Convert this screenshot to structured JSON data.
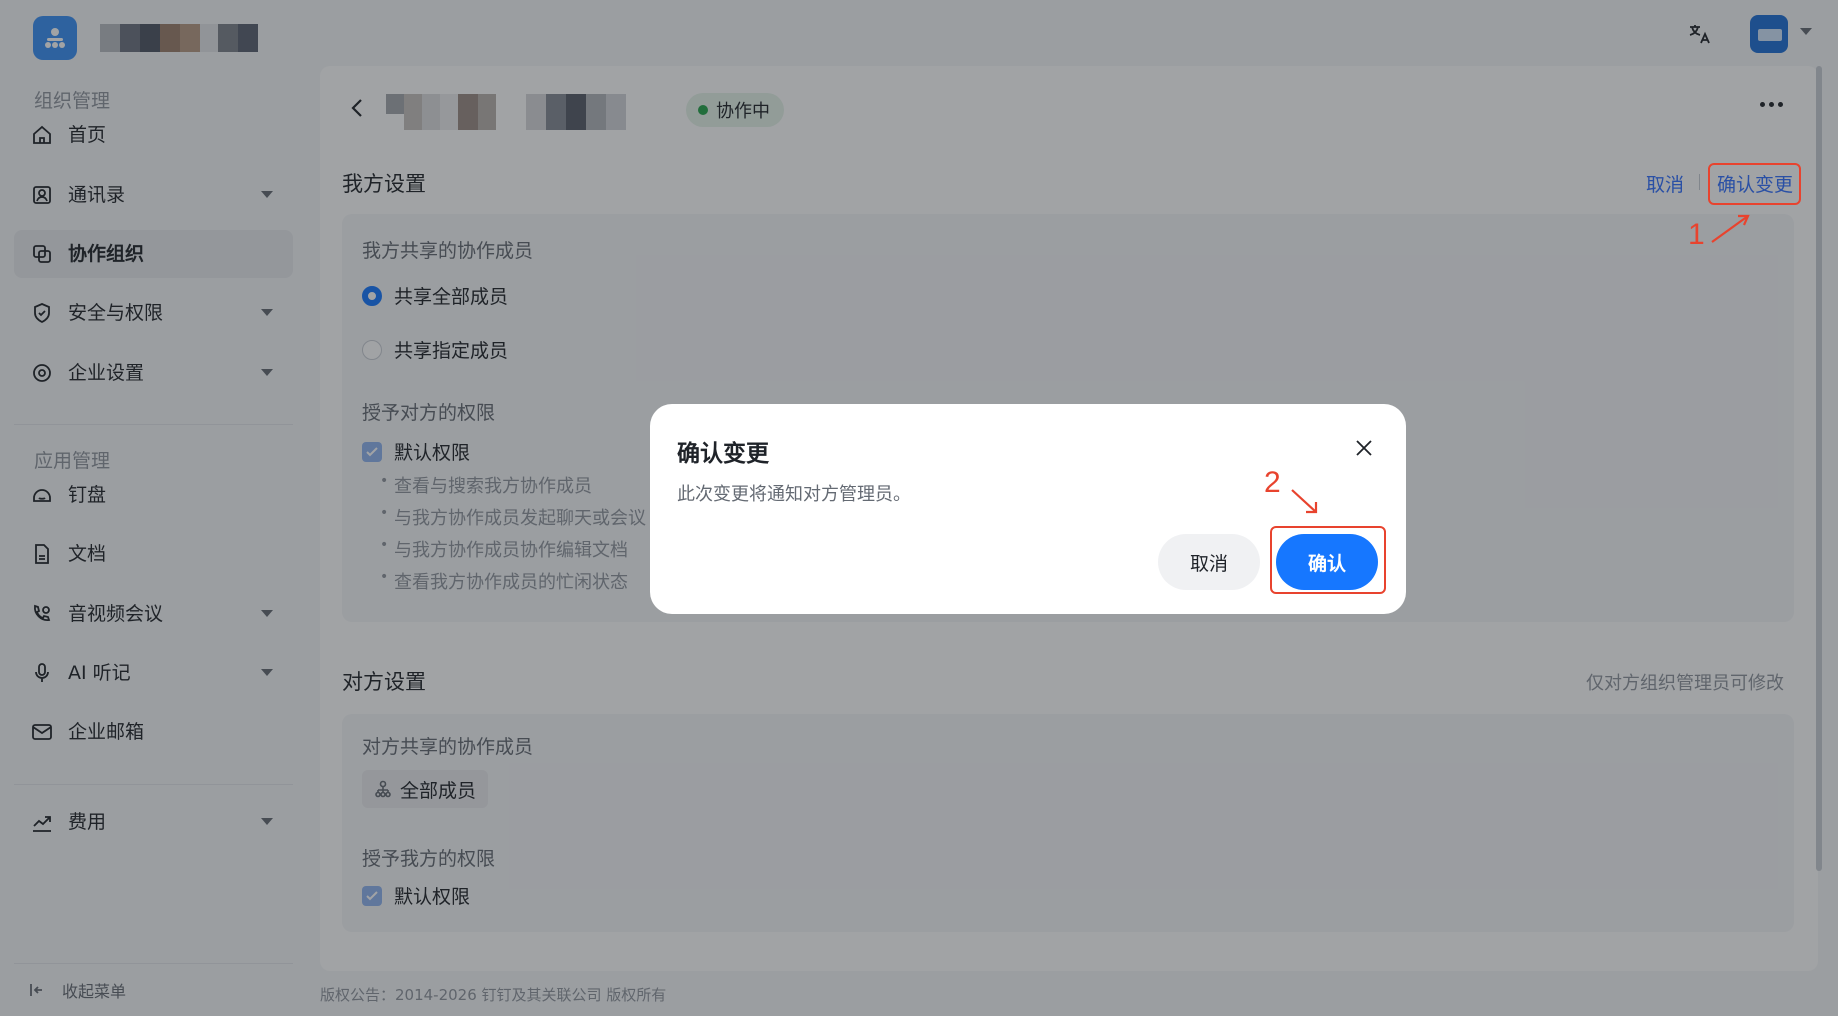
{
  "sidebar": {
    "section_org": "组织管理",
    "section_app": "应用管理",
    "items": [
      {
        "label": "首页"
      },
      {
        "label": "通讯录"
      },
      {
        "label": "协作组织"
      },
      {
        "label": "安全与权限"
      },
      {
        "label": "企业设置"
      },
      {
        "label": "钉盘"
      },
      {
        "label": "文档"
      },
      {
        "label": "音视频会议"
      },
      {
        "label": "AI 听记"
      },
      {
        "label": "企业邮箱"
      },
      {
        "label": "费用"
      }
    ],
    "collapse_label": "收起菜单"
  },
  "header": {
    "status": "协作中"
  },
  "my_settings": {
    "title": "我方设置",
    "cancel": "取消",
    "confirm_change": "确认变更",
    "shared_members_title": "我方共享的协作成员",
    "option_all": "共享全部成员",
    "option_specific": "共享指定成员",
    "permissions_title": "授予对方的权限",
    "default_permission": "默认权限",
    "permission_items": [
      "查看与搜索我方协作成员",
      "与我方协作成员发起聊天或会议",
      "与我方协作成员协作编辑文档",
      "查看我方协作成员的忙闲状态"
    ]
  },
  "their_settings": {
    "title": "对方设置",
    "hint": "仅对方组织管理员可修改",
    "shared_members_title": "对方共享的协作成员",
    "all_members": "全部成员",
    "permissions_title": "授予我方的权限",
    "default_permission": "默认权限"
  },
  "footer": {
    "copyright": "版权公告：2014-2026 钉钉及其关联公司 版权所有"
  },
  "dialog": {
    "title": "确认变更",
    "description": "此次变更将通知对方管理员。",
    "cancel": "取消",
    "confirm": "确认"
  },
  "annotations": {
    "step1": "1",
    "step2": "2"
  },
  "colors": {
    "accent": "#1677ff",
    "link": "#3370ff",
    "status_green": "#25a44a",
    "annotation_red": "#e8432e"
  }
}
